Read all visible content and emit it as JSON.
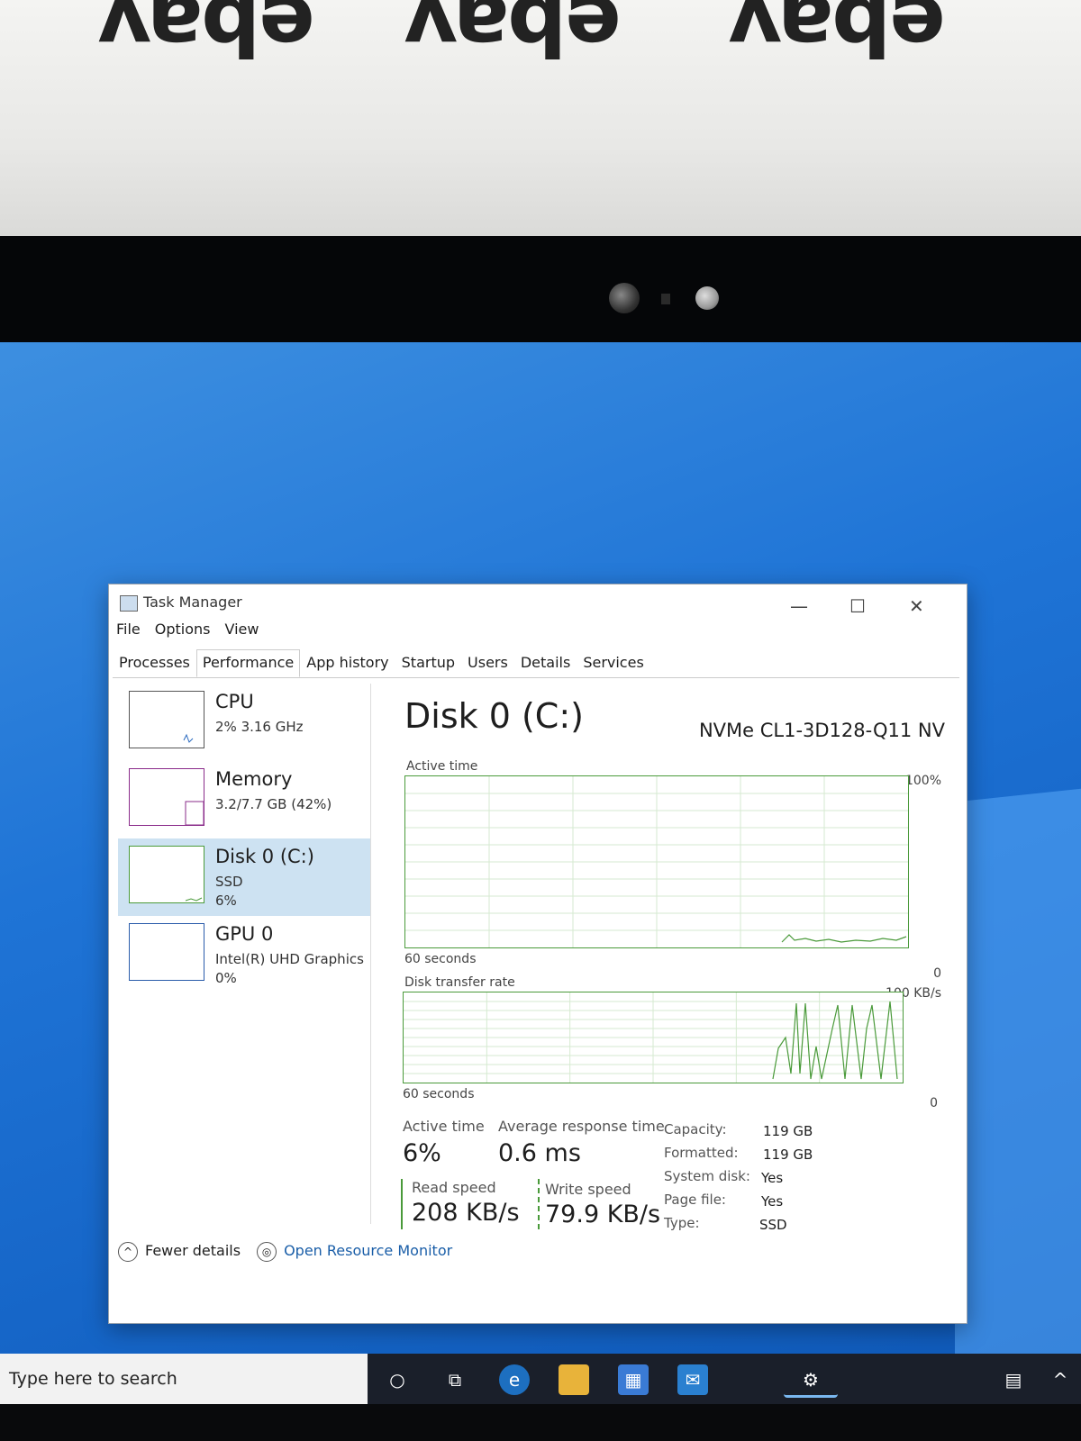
{
  "backdrop": {
    "watermark": [
      "ebay",
      "ebay",
      "ebay"
    ]
  },
  "window": {
    "title": "Task Manager",
    "minimize_glyph": "—",
    "maximize_glyph": "☐",
    "close_glyph": "✕"
  },
  "menu": {
    "file": "File",
    "options": "Options",
    "view": "View"
  },
  "tabs": [
    {
      "label": "Processes",
      "active": false
    },
    {
      "label": "Performance",
      "active": true
    },
    {
      "label": "App history",
      "active": false
    },
    {
      "label": "Startup",
      "active": false
    },
    {
      "label": "Users",
      "active": false
    },
    {
      "label": "Details",
      "active": false
    },
    {
      "label": "Services",
      "active": false
    }
  ],
  "sidebar": {
    "items": [
      {
        "name": "CPU",
        "sub": "2% 3.16 GHz"
      },
      {
        "name": "Memory",
        "sub": "3.2/7.7 GB (42%)"
      },
      {
        "name": "Disk 0 (C:)",
        "sub": "SSD\n6%"
      },
      {
        "name": "GPU 0",
        "sub": "Intel(R) UHD Graphics\n0%"
      }
    ]
  },
  "main": {
    "title": "Disk 0 (C:)",
    "model": "NVMe CL1-3D128-Q11 NV",
    "graph1": {
      "label": "Active time",
      "max": "100%",
      "time": "60 seconds",
      "min": "0"
    },
    "graph2": {
      "label": "Disk transfer rate",
      "max": "100 KB/s",
      "time": "60 seconds",
      "min": "0"
    },
    "stats": {
      "active_time_label": "Active time",
      "active_time_value": "6%",
      "avg_response_label": "Average response time",
      "avg_response_value": "0.6 ms",
      "read_speed_label": "Read speed",
      "read_speed_value": "208 KB/s",
      "write_speed_label": "Write speed",
      "write_speed_value": "79.9 KB/s"
    },
    "properties": [
      {
        "key": "Capacity:",
        "value": "119 GB"
      },
      {
        "key": "Formatted:",
        "value": "119 GB"
      },
      {
        "key": "System disk:",
        "value": "Yes"
      },
      {
        "key": "Page file:",
        "value": "Yes"
      },
      {
        "key": "Type:",
        "value": "SSD"
      }
    ]
  },
  "footer": {
    "fewer_details": "Fewer details",
    "resource_monitor": "Open Resource Monitor"
  },
  "taskbar": {
    "search_placeholder": "Type here to search"
  },
  "colors": {
    "disk_green": "#4a9a3a",
    "accent_blue": "#1666c8"
  }
}
